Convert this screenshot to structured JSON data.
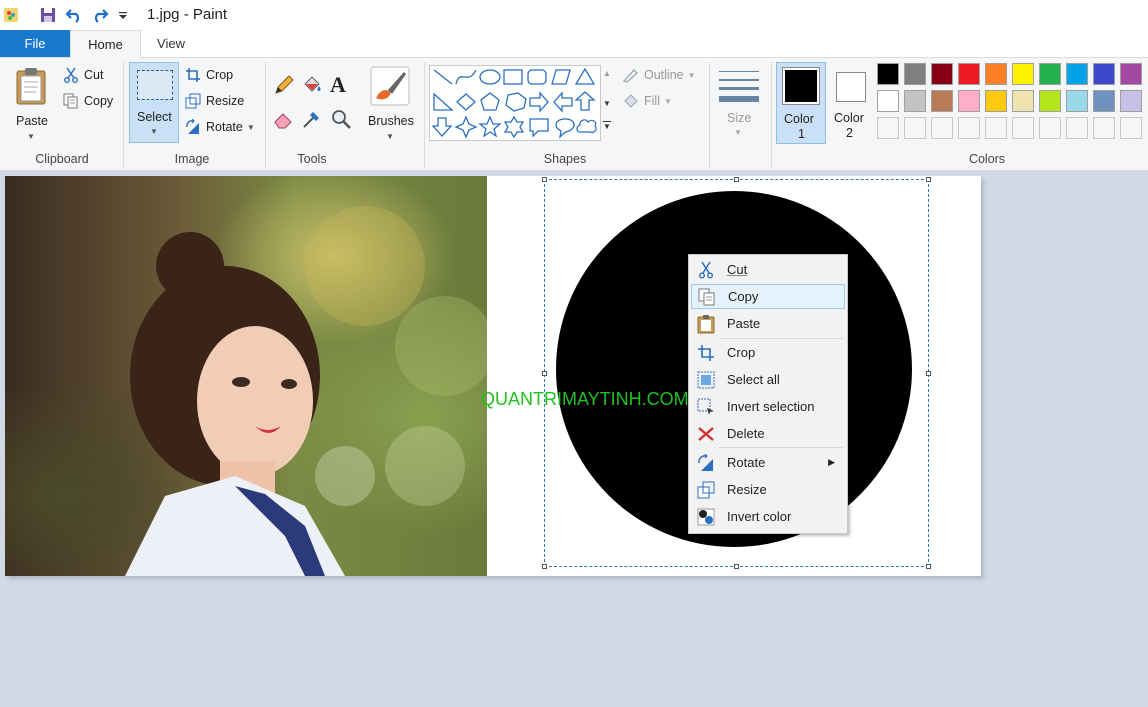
{
  "titlebar": {
    "title": "1.jpg - Paint"
  },
  "tabs": {
    "file": "File",
    "home": "Home",
    "view": "View"
  },
  "clipboard": {
    "paste": "Paste",
    "cut": "Cut",
    "copy": "Copy",
    "label": "Clipboard"
  },
  "image": {
    "select": "Select",
    "crop": "Crop",
    "resize": "Resize",
    "rotate": "Rotate",
    "label": "Image"
  },
  "tools": {
    "label": "Tools",
    "brushes": "Brushes"
  },
  "shapes": {
    "label": "Shapes",
    "outline": "Outline",
    "fill": "Fill",
    "size": "Size"
  },
  "colors": {
    "color1_l1": "Color",
    "color1_l2": "1",
    "color2_l1": "Color",
    "color2_l2": "2",
    "label": "Colors",
    "color1_value": "#000000",
    "color2_value": "#ffffff",
    "palette_row1": [
      "#000000",
      "#7f7f7f",
      "#880015",
      "#ed1c24",
      "#ff7f27",
      "#fff200",
      "#22b14c",
      "#00a2e8",
      "#3f48cc",
      "#a349a4"
    ],
    "palette_row2": [
      "#ffffff",
      "#c3c3c3",
      "#b97a57",
      "#ffaec9",
      "#ffc90e",
      "#efe4b0",
      "#b5e61d",
      "#99d9ea",
      "#7092be",
      "#c8bfe7"
    ]
  },
  "canvas": {
    "watermark": "QUANTRIMAYTINH.COM"
  },
  "context_menu": {
    "items": [
      {
        "label": "Cut",
        "icon": "scissors-icon"
      },
      {
        "label": "Copy",
        "icon": "copy-icon",
        "highlighted": true
      },
      {
        "label": "Paste",
        "icon": "clipboard-icon"
      },
      {
        "label": "Crop",
        "icon": "crop-icon"
      },
      {
        "label": "Select all",
        "icon": "select-all-icon"
      },
      {
        "label": "Invert selection",
        "icon": "invert-selection-icon"
      },
      {
        "label": "Delete",
        "icon": "delete-icon"
      },
      {
        "label": "Rotate",
        "icon": "rotate-icon",
        "submenu": true
      },
      {
        "label": "Resize",
        "icon": "resize-icon"
      },
      {
        "label": "Invert color",
        "icon": "invert-color-icon"
      }
    ]
  }
}
